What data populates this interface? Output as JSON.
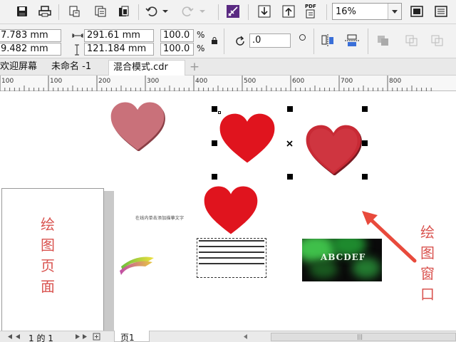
{
  "toolbar": {
    "zoom_value": "16%",
    "pdf_label": "PDF",
    "icons": [
      "save-icon",
      "print-icon",
      "import-icon",
      "export-icon",
      "clipboard-icon",
      "undo-icon",
      "redo-icon",
      "launcher-icon",
      "import-down-icon",
      "export-up-icon",
      "publish-pdf-icon",
      "fullscreen-icon",
      "options-icon"
    ]
  },
  "propbar": {
    "x": "7.783 mm",
    "y": "9.482 mm",
    "width": "291.61 mm",
    "height": "121.184 mm",
    "scale_w": "100.0",
    "scale_h": "100.0",
    "pct": "%",
    "rotation": ".0",
    "accent": "#3a6fd8"
  },
  "tabs": [
    {
      "label": "欢迎屏幕"
    },
    {
      "label": "未命名 -1"
    },
    {
      "label": "混合模式.cdr"
    }
  ],
  "tab_plus": "+",
  "ruler": {
    "labels": [
      "100",
      "100",
      "200",
      "300",
      "400",
      "500",
      "600",
      "700",
      "800"
    ]
  },
  "canvas": {
    "page_label": [
      "绘",
      "图",
      "页",
      "面"
    ],
    "window_label": [
      "绘",
      "图",
      "窗",
      "口"
    ],
    "tiny_text": "在线内单击添加描摹文字",
    "gradient_text": "ABCDEF",
    "heart_colors": {
      "pink": "#c9717a",
      "red": "#e0141e",
      "crimson": "#c82a35"
    },
    "arrow_color": "#e84a3c"
  },
  "statusbar": {
    "page_indicator": "1 的 1",
    "page_tab": "页1"
  }
}
